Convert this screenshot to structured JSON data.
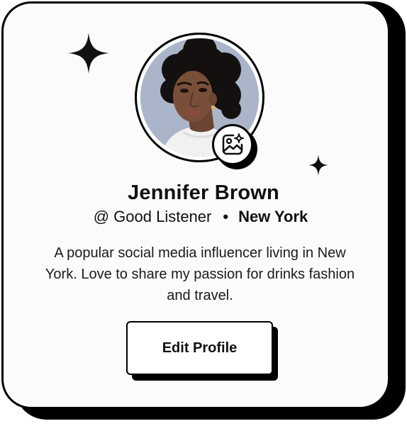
{
  "profile": {
    "name": "Jennifer Brown",
    "handle": "@ Good Listener",
    "separator": "•",
    "location": "New York",
    "bio": "A popular social media influencer living in New York. Love to share my passion for drinks fashion and travel."
  },
  "actions": {
    "edit_profile_label": "Edit Profile"
  },
  "icons": {
    "edit_photo": "image-sparkle-icon",
    "decor_large": "sparkle-icon",
    "decor_small": "sparkle-icon"
  },
  "colors": {
    "border": "#000000",
    "card_background": "#fbfbfb",
    "avatar_background": "#aab5c9"
  }
}
